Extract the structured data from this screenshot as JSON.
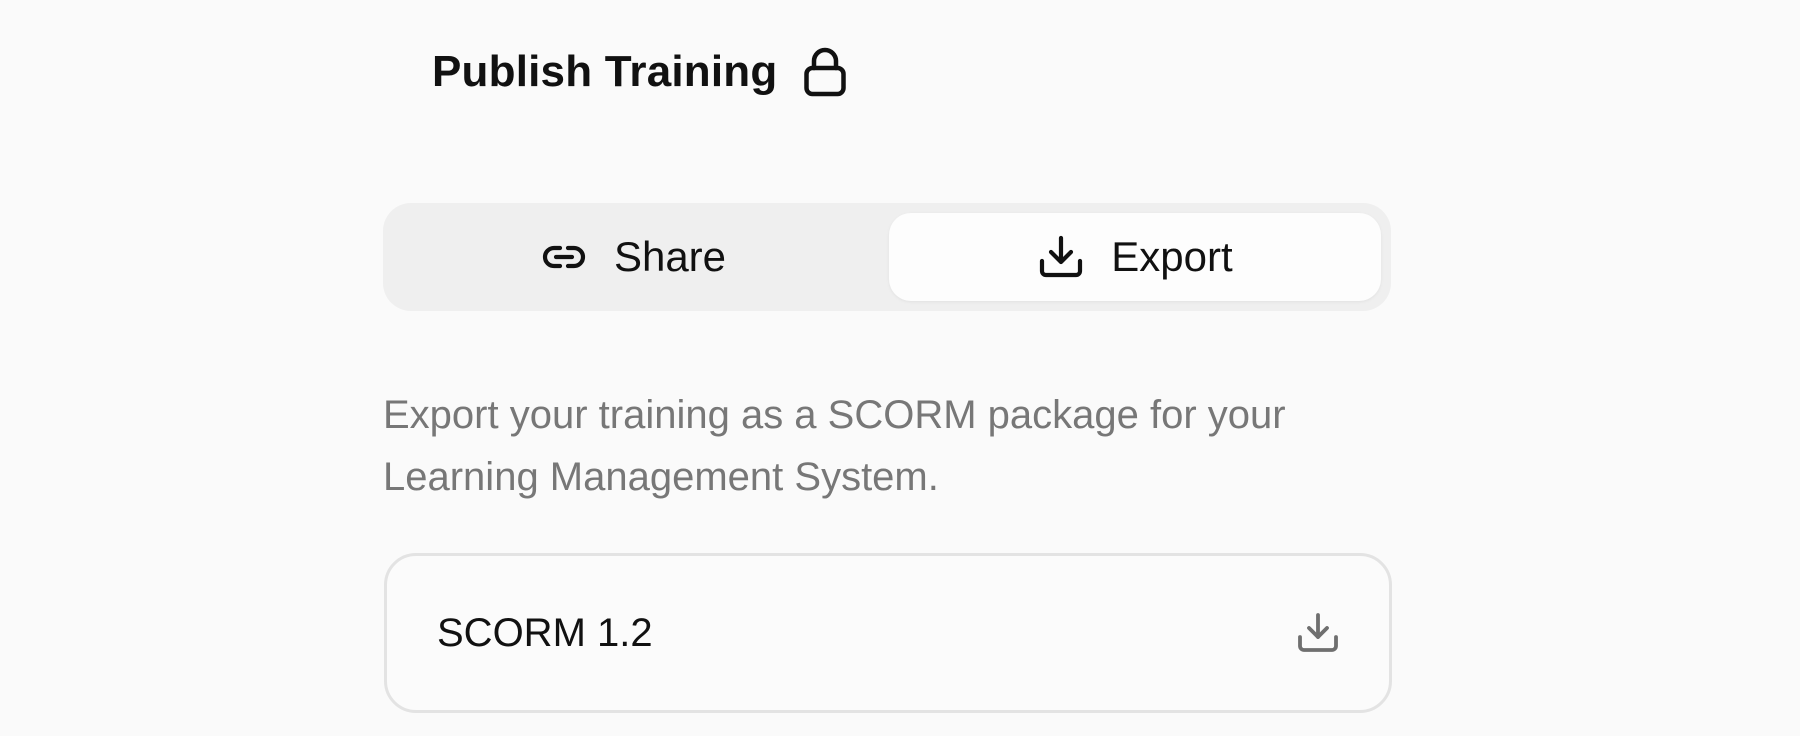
{
  "header": {
    "title": "Publish Training",
    "icon": "lock-icon"
  },
  "tabs": [
    {
      "label": "Share",
      "icon": "link-icon",
      "selected": false
    },
    {
      "label": "Export",
      "icon": "download-icon",
      "selected": true
    }
  ],
  "export": {
    "description": "Export your training as a SCORM package for your Learning Management System.",
    "options": [
      {
        "label": "SCORM 1.2",
        "icon": "download-icon"
      }
    ]
  },
  "colors": {
    "background": "#fafafa",
    "segmented_track": "#efefef",
    "selected_tab": "#fdfdfd",
    "text_primary": "#111111",
    "text_secondary": "#777777",
    "card_border": "#e3e3e3"
  }
}
